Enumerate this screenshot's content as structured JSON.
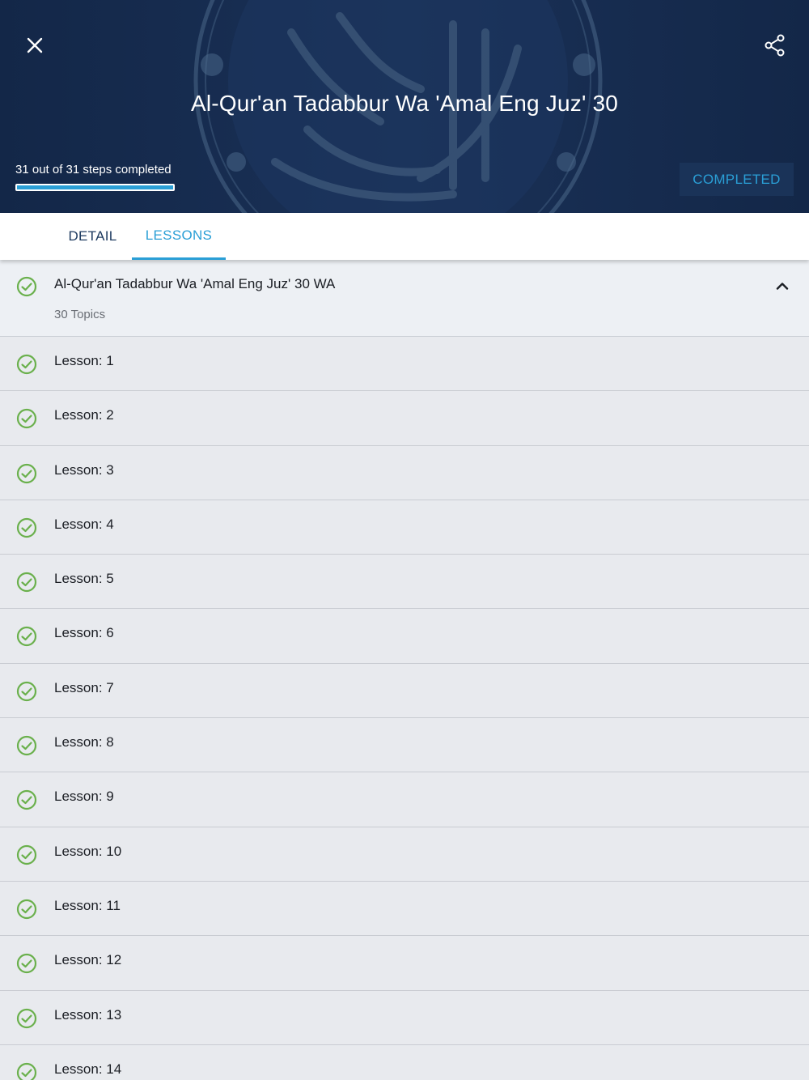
{
  "header": {
    "title": "Al-Qur'an Tadabbur Wa 'Amal Eng Juz' 30",
    "progress_text": "31 out of 31 steps completed",
    "progress_fraction": 1.0,
    "status_label": "COMPLETED",
    "close_icon": "close-icon",
    "share_icon": "share-icon"
  },
  "tabs": [
    {
      "label": "DETAIL",
      "active": false
    },
    {
      "label": "LESSONS",
      "active": true
    }
  ],
  "section": {
    "title": "Al-Qur'an Tadabbur Wa 'Amal Eng Juz' 30 WA",
    "subtitle": "30 Topics",
    "toggle_icon": "chevron-up-icon"
  },
  "lessons": [
    {
      "label": "Lesson: 1"
    },
    {
      "label": "Lesson: 2"
    },
    {
      "label": "Lesson: 3"
    },
    {
      "label": "Lesson: 4"
    },
    {
      "label": "Lesson: 5"
    },
    {
      "label": "Lesson: 6"
    },
    {
      "label": "Lesson: 7"
    },
    {
      "label": "Lesson: 8"
    },
    {
      "label": "Lesson: 9"
    },
    {
      "label": "Lesson: 10"
    },
    {
      "label": "Lesson: 11"
    },
    {
      "label": "Lesson: 12"
    },
    {
      "label": "Lesson: 13"
    },
    {
      "label": "Lesson: 14"
    }
  ],
  "colors": {
    "header_bg": "#152a4d",
    "accent": "#2a9fd6",
    "check_green": "#6ab04c"
  }
}
